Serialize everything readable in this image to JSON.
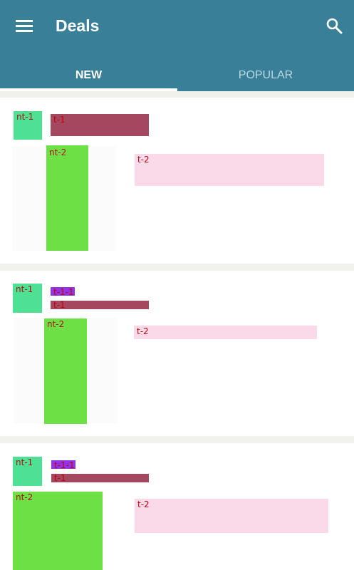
{
  "appbar": {
    "title": "Deals",
    "menu_icon": "hamburger-menu-icon",
    "search_icon": "search-icon",
    "color": "#387f97"
  },
  "tabs": [
    {
      "label": "NEW",
      "selected": true
    },
    {
      "label": "POPULAR",
      "selected": false
    }
  ],
  "cards": [
    {
      "avatar": "nt-1",
      "title": "t-1",
      "image": "nt-2",
      "description": "t-2"
    },
    {
      "avatar": "nt-1",
      "tag": "t-1-1",
      "title": "t-1",
      "image": "nt-2",
      "description": "t-2"
    },
    {
      "avatar": "nt-1",
      "tag": "t-1-1",
      "title": "t-1",
      "image": "nt-2",
      "description": "t-2"
    }
  ]
}
